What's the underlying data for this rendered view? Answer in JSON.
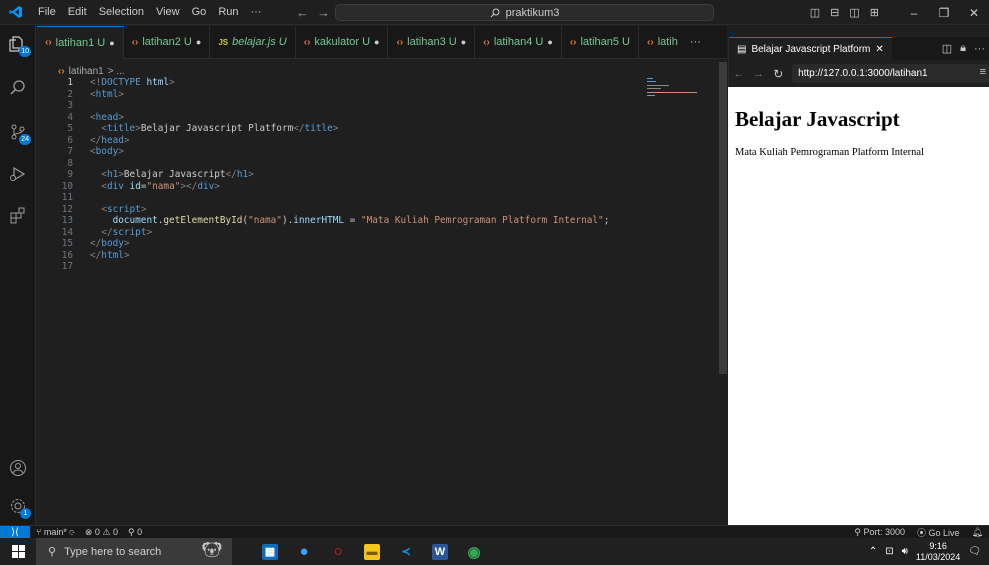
{
  "titlebar": {
    "menu": [
      "File",
      "Edit",
      "Selection",
      "View",
      "Go",
      "Run",
      "···"
    ],
    "search_text": "praktikum3"
  },
  "activity": {
    "explorer_badge": "10",
    "source_control_badge": "24",
    "settings_badge": "1"
  },
  "tabs": [
    {
      "name": "latihan1 U",
      "icon": "html-icon",
      "modified": true,
      "active": true
    },
    {
      "name": "latihan2 U",
      "icon": "html-icon",
      "modified": true
    },
    {
      "name": "belajar.js U",
      "icon": "js-icon",
      "italic": true
    },
    {
      "name": "kakulator U",
      "icon": "html-icon",
      "modified": true
    },
    {
      "name": "latihan3 U",
      "icon": "html-icon",
      "modified": true
    },
    {
      "name": "latihan4 U",
      "icon": "html-icon",
      "modified": true
    },
    {
      "name": "latihan5 U",
      "icon": "html-icon"
    },
    {
      "name": "latih",
      "icon": "html-icon"
    }
  ],
  "breadcrumb": {
    "file": "latihan1",
    "sep": "> ..."
  },
  "code_lines": [
    {
      "n": "1",
      "html": "<span class=\"tg\">&lt;!</span><span class=\"tn2\">DOCTYPE</span> <span class=\"at\">html</span><span class=\"tg\">&gt;</span>"
    },
    {
      "n": "2",
      "html": "<span class=\"tg\">&lt;</span><span class=\"tn2\">html</span><span class=\"tg\">&gt;</span>"
    },
    {
      "n": "3",
      "html": ""
    },
    {
      "n": "4",
      "html": "<span class=\"tg\">&lt;</span><span class=\"tn2\">head</span><span class=\"tg\">&gt;</span>"
    },
    {
      "n": "5",
      "html": "  <span class=\"tg\">&lt;</span><span class=\"tn2\">title</span><span class=\"tg\">&gt;</span>Belajar Javascript Platform<span class=\"tg\">&lt;/</span><span class=\"tn2\">title</span><span class=\"tg\">&gt;</span>"
    },
    {
      "n": "6",
      "html": "<span class=\"tg\">&lt;/</span><span class=\"tn2\">head</span><span class=\"tg\">&gt;</span>"
    },
    {
      "n": "7",
      "html": "<span class=\"tg\">&lt;</span><span class=\"tn2\">body</span><span class=\"tg\">&gt;</span>"
    },
    {
      "n": "8",
      "html": ""
    },
    {
      "n": "9",
      "html": "  <span class=\"tg\">&lt;</span><span class=\"tn2\">h1</span><span class=\"tg\">&gt;</span>Belajar Javascript<span class=\"tg\">&lt;/</span><span class=\"tn2\">h1</span><span class=\"tg\">&gt;</span>"
    },
    {
      "n": "10",
      "html": "  <span class=\"tg\">&lt;</span><span class=\"tn2\">div</span> <span class=\"at\">id</span>=<span class=\"st\">\"nama\"</span><span class=\"tg\">&gt;&lt;/</span><span class=\"tn2\">div</span><span class=\"tg\">&gt;</span>"
    },
    {
      "n": "11",
      "html": ""
    },
    {
      "n": "12",
      "html": "  <span class=\"tg\">&lt;</span><span class=\"tn2\">script</span><span class=\"tg\">&gt;</span>"
    },
    {
      "n": "13",
      "html": "    <span class=\"vr\">document</span>.<span class=\"fn\">getElementById</span>(<span class=\"st\">\"nama\"</span>).<span class=\"vr\">innerHTML</span> = <span class=\"st\">\"Mata Kuliah Pemrograman Platform Internal\"</span>;"
    },
    {
      "n": "14",
      "html": "  <span class=\"tg\">&lt;/</span><span class=\"tn2\">script</span><span class=\"tg\">&gt;</span>"
    },
    {
      "n": "15",
      "html": "<span class=\"tg\">&lt;/</span><span class=\"tn2\">body</span><span class=\"tg\">&gt;</span>"
    },
    {
      "n": "16",
      "html": "<span class=\"tg\">&lt;/</span><span class=\"tn2\">html</span><span class=\"tg\">&gt;</span>"
    },
    {
      "n": "17",
      "html": ""
    }
  ],
  "preview": {
    "tab_title": "Belajar Javascript Platform",
    "url": "http://127.0.0.1:3000/latihan1",
    "heading": "Belajar Javascript",
    "paragraph": "Mata Kuliah Pemrograman Platform Internal"
  },
  "statusbar": {
    "branch": "main*",
    "errors": "0",
    "warnings": "0",
    "ports": "0",
    "port_label": "Port: 3000",
    "go_live": "Go Live"
  },
  "taskbar": {
    "search_placeholder": "Type here to search",
    "time": "9:16",
    "date": "11/03/2024"
  }
}
